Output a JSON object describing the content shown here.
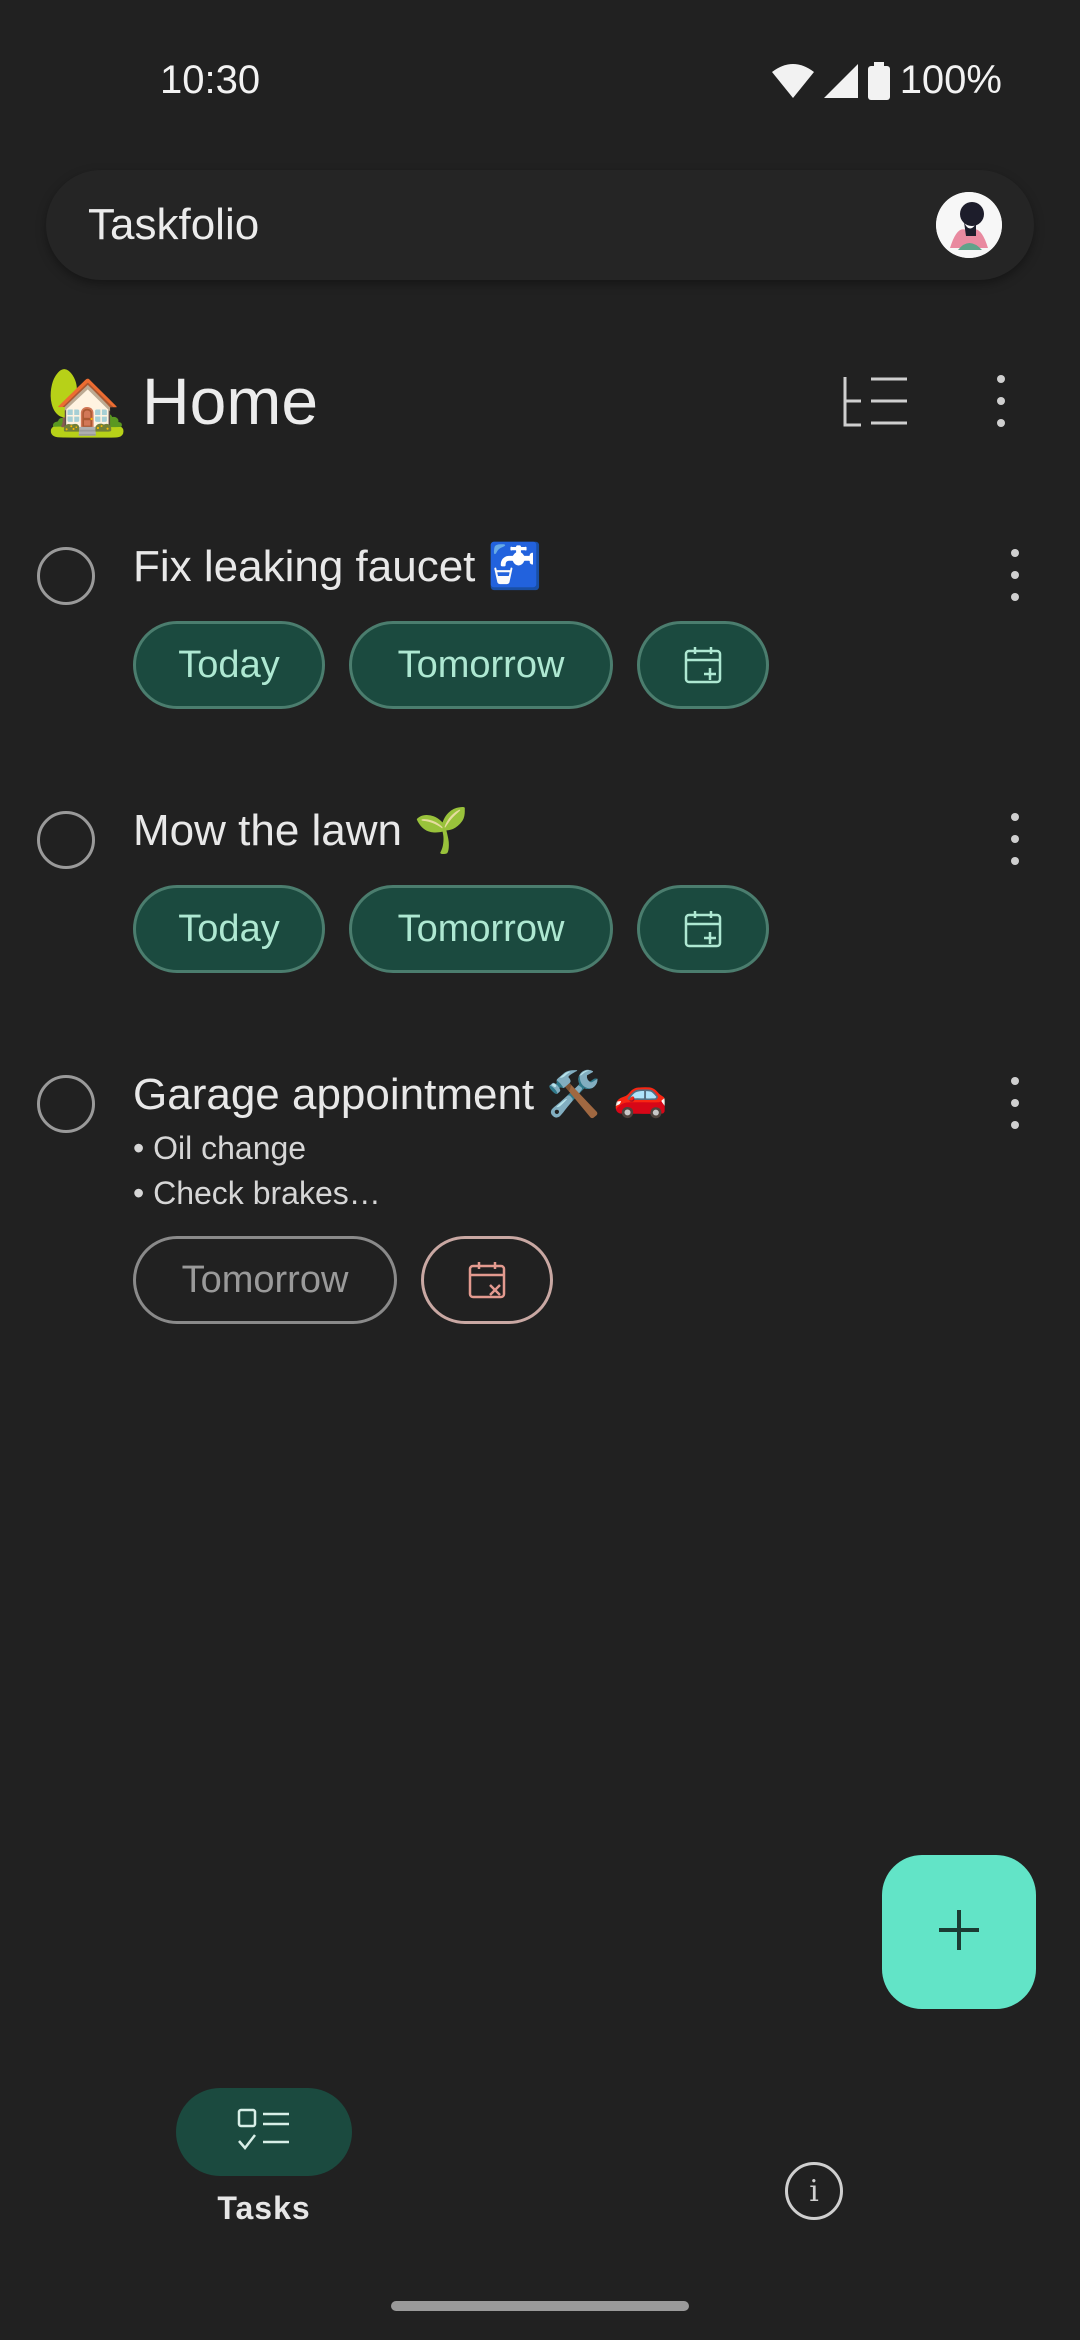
{
  "status": {
    "time": "10:30",
    "battery": "100%"
  },
  "app": {
    "title": "Taskfolio"
  },
  "list": {
    "emoji": "🏡",
    "title": "Home"
  },
  "tasks": [
    {
      "title": "Fix leaking faucet 🚰",
      "chips": {
        "today": "Today",
        "tomorrow": "Tomorrow"
      }
    },
    {
      "title": "Mow the lawn 🌱",
      "chips": {
        "today": "Today",
        "tomorrow": "Tomorrow"
      }
    },
    {
      "title": "Garage appointment 🛠️ 🚗",
      "notes": [
        "• Oil change",
        "• Check brakes…"
      ],
      "chips": {
        "tomorrow": "Tomorrow"
      }
    }
  ],
  "nav": {
    "tasks_label": "Tasks",
    "info_glyph": "i"
  },
  "colors": {
    "background": "#212121",
    "accent": "#62e4c7",
    "chip_fill": "#1b4a3f",
    "chip_text": "#aee8d2"
  },
  "icons": [
    "wifi-icon",
    "signal-icon",
    "battery-icon",
    "sort-icon",
    "more-vert-icon",
    "calendar-add-icon",
    "calendar-remove-icon",
    "plus-icon",
    "tasks-icon",
    "info-icon"
  ]
}
